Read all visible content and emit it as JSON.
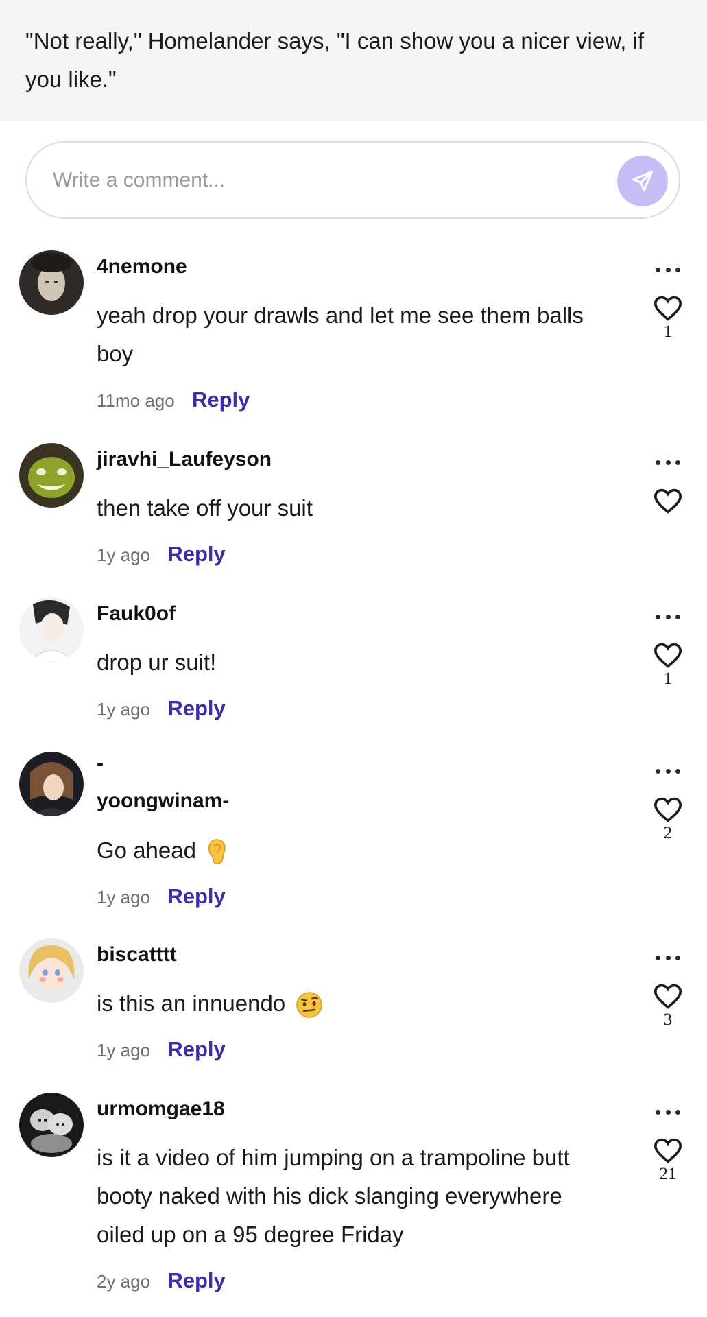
{
  "story": {
    "excerpt": "\"Not really,\" Homelander says, \"I can show you a nicer view, if you like.\""
  },
  "comment_box": {
    "placeholder": "Write a comment...",
    "send_icon": "send-arrow-icon"
  },
  "comments": [
    {
      "username": "4nemone",
      "text": "yeah drop your drawls and let me see them balls boy",
      "time": "11mo ago",
      "reply_label": "Reply",
      "likes": "1"
    },
    {
      "username": "jiravhi_Laufeyson",
      "text": "then take off your suit",
      "time": "1y ago",
      "reply_label": "Reply",
      "likes": ""
    },
    {
      "username": "Fauk0of",
      "text": "drop ur suit!",
      "time": "1y ago",
      "reply_label": "Reply",
      "likes": "1"
    },
    {
      "username_line1": "-",
      "username_line2": "yoongwinam-",
      "text": "Go ahead",
      "emoji": "ear-emoji",
      "time": "1y ago",
      "reply_label": "Reply",
      "likes": "2"
    },
    {
      "username": "biscatttt",
      "text": "is this an innuendo",
      "emoji": "raised-eyebrow-emoji",
      "time": "1y ago",
      "reply_label": "Reply",
      "likes": "3"
    },
    {
      "username": "urmomgae18",
      "text": "is it a video of him jumping on a trampoline butt booty naked with his dick slanging everywhere oiled up on a 95 degree Friday",
      "time": "2y ago",
      "reply_label": "Reply",
      "likes": "21"
    }
  ],
  "colors": {
    "accent": "#3d2ba8",
    "send_button": "#c9bdf6",
    "excerpt_background": "#f4f4f4"
  }
}
